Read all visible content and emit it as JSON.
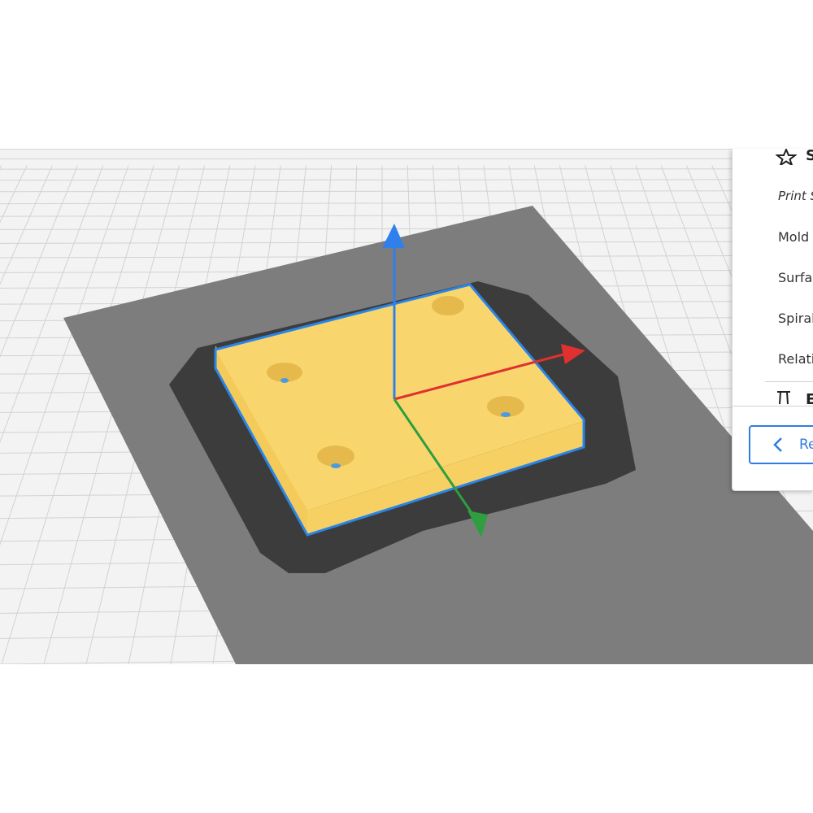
{
  "viewport": {
    "colors": {
      "floor": "#f3f3f3",
      "grid_line": "#d2d2d2",
      "build_area": "#7d7d7d",
      "shadow": "#3c3c3c",
      "model_top": "#f9d66d",
      "model_side": "#f1c757",
      "outline": "#2a85e8",
      "axis_z": "#2f80ed",
      "axis_x": "#e03030",
      "axis_y": "#2e9e3e"
    }
  },
  "panel": {
    "header": {
      "icon": "star-icon",
      "label": "S"
    },
    "print_setting_label": "Print S",
    "rows": [
      "Mold",
      "Surfa",
      "Spiral",
      "Relati"
    ],
    "section2": {
      "icon": "pi-icon",
      "label": "E"
    },
    "recommended_button": {
      "label": "Re",
      "icon": "chevron-left-icon"
    }
  }
}
